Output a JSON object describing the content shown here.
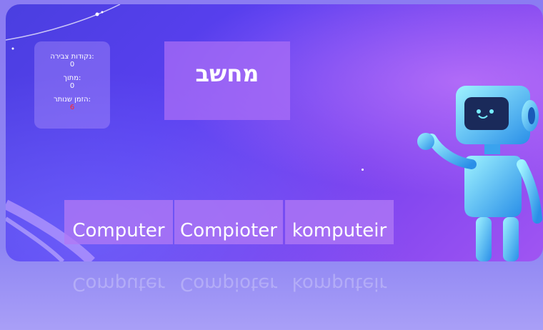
{
  "score_panel": {
    "points_label": "נקודות צבירה:",
    "points_value": "0",
    "of_label": "מתוך:",
    "of_value": "0",
    "time_label": "הזמן שנותר:",
    "time_value": "6"
  },
  "question": {
    "word": "מחשב"
  },
  "options": [
    {
      "label": "Computer"
    },
    {
      "label": "Compioter"
    },
    {
      "label": "komputeir"
    }
  ],
  "colors": {
    "time_value": "#ff2a2a",
    "background_start": "#4a3fe0",
    "background_end": "#a055f2"
  }
}
